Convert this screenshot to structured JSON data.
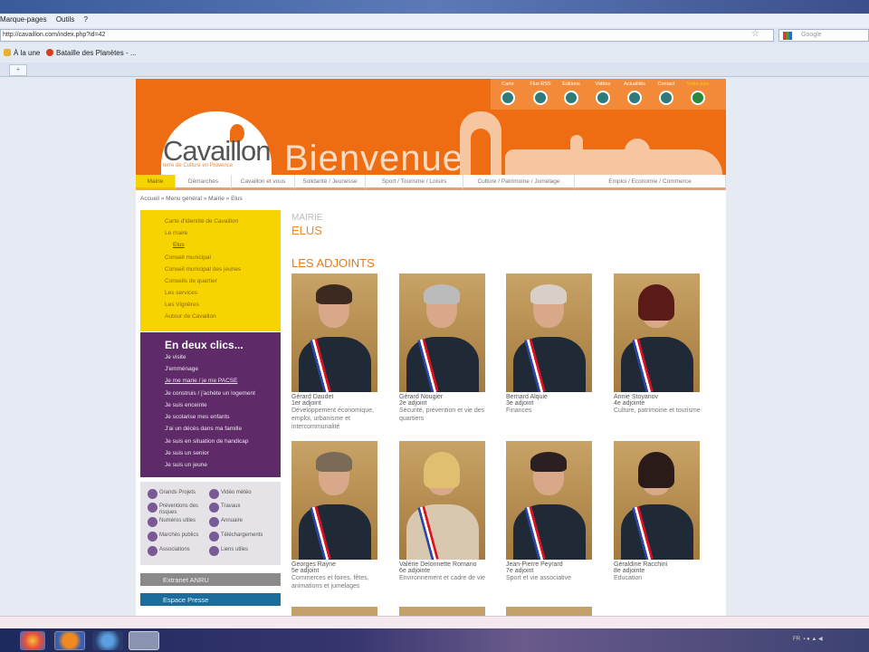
{
  "browser": {
    "menu": [
      "Marque-pages",
      "Outils",
      "?"
    ],
    "url": "http://cavaillon.com/index.php?id=42",
    "search_placeholder": "Google",
    "bookmarks": [
      "À la une",
      "Bataille des Planètes - ..."
    ],
    "new_tab": "+"
  },
  "site": {
    "logo": "Cavaillon",
    "logo_tagline": "terre de Culture en Provence",
    "banner": "Bienvenue",
    "toplinks": [
      "Carte",
      "Flux RSS",
      "Editions",
      "Vidéos",
      "Actualités",
      "Contact",
      "Votre avis"
    ],
    "nav": [
      "Mairie",
      "Démarches",
      "Cavaillon et vous",
      "Solidarité / Jeunesse",
      "Sport / Tourisme / Loisirs",
      "Culture / Patrimoine / Jumelage",
      "Emploi / Economie / Commerce"
    ],
    "breadcrumb": "Accueil » Menu général » Mairie » Elus",
    "sidebar_menu": [
      "Carte d'identité de Cavaillon",
      "Le maire",
      "Elus",
      "Conseil municipal",
      "Conseil municipal des jeunes",
      "Conseils de quartier",
      "Les services",
      "Les Vignères",
      "Autour de Cavaillon"
    ],
    "clics_title": "En deux clics...",
    "clics": [
      "Je visite",
      "J'emménage",
      "Je me marie / je me PACSE",
      "Je construis / j'achète un logement",
      "Je suis enceinte",
      "Je scolarise mes enfants",
      "J'ai un décès dans ma famille",
      "Je suis en situation de handicap",
      "Je suis un senior",
      "Je suis un jeune"
    ],
    "quick_links": [
      "Grands Projets",
      "Vidéo météo",
      "Préventions des risques",
      "Travaux",
      "Numéros utiles",
      "Annuaire",
      "Marchés publics",
      "Téléchargements",
      "Associations",
      "Liens utiles"
    ],
    "extranet": "Extranet ANRU",
    "presse": "Espace Presse",
    "section": "MAIRIE",
    "page_title": "ELUS",
    "subtitle": "LES ADJOINTS",
    "adjoints": [
      {
        "name": "Gérard Daudet",
        "role": "1er adjoint",
        "desc": "Développement économique, emploi, urbanisme et intercommunalité"
      },
      {
        "name": "Gérard Nougier",
        "role": "2e adjoint",
        "desc": "Sécurité, prévention et vie des quartiers"
      },
      {
        "name": "Bernard Alquie",
        "role": "3e adjoint",
        "desc": "Finances"
      },
      {
        "name": "Annie Stoyanov",
        "role": "4e adjointe",
        "desc": "Culture, patrimoine et tourisme"
      },
      {
        "name": "Georges Rayne",
        "role": "5e adjoint",
        "desc": "Commerces et foires, fêtes, animations et jumelages"
      },
      {
        "name": "Valérie Delonnette Romano",
        "role": "6e adjointe",
        "desc": "Environnement et cadre de vie"
      },
      {
        "name": "Jean-Pierre Peyrard",
        "role": "7e adjoint",
        "desc": "Sport et vie associative"
      },
      {
        "name": "Géraldine Racchini",
        "role": "8e adjointe",
        "desc": "Education"
      }
    ]
  },
  "taskbar": {
    "lang": "FR"
  }
}
